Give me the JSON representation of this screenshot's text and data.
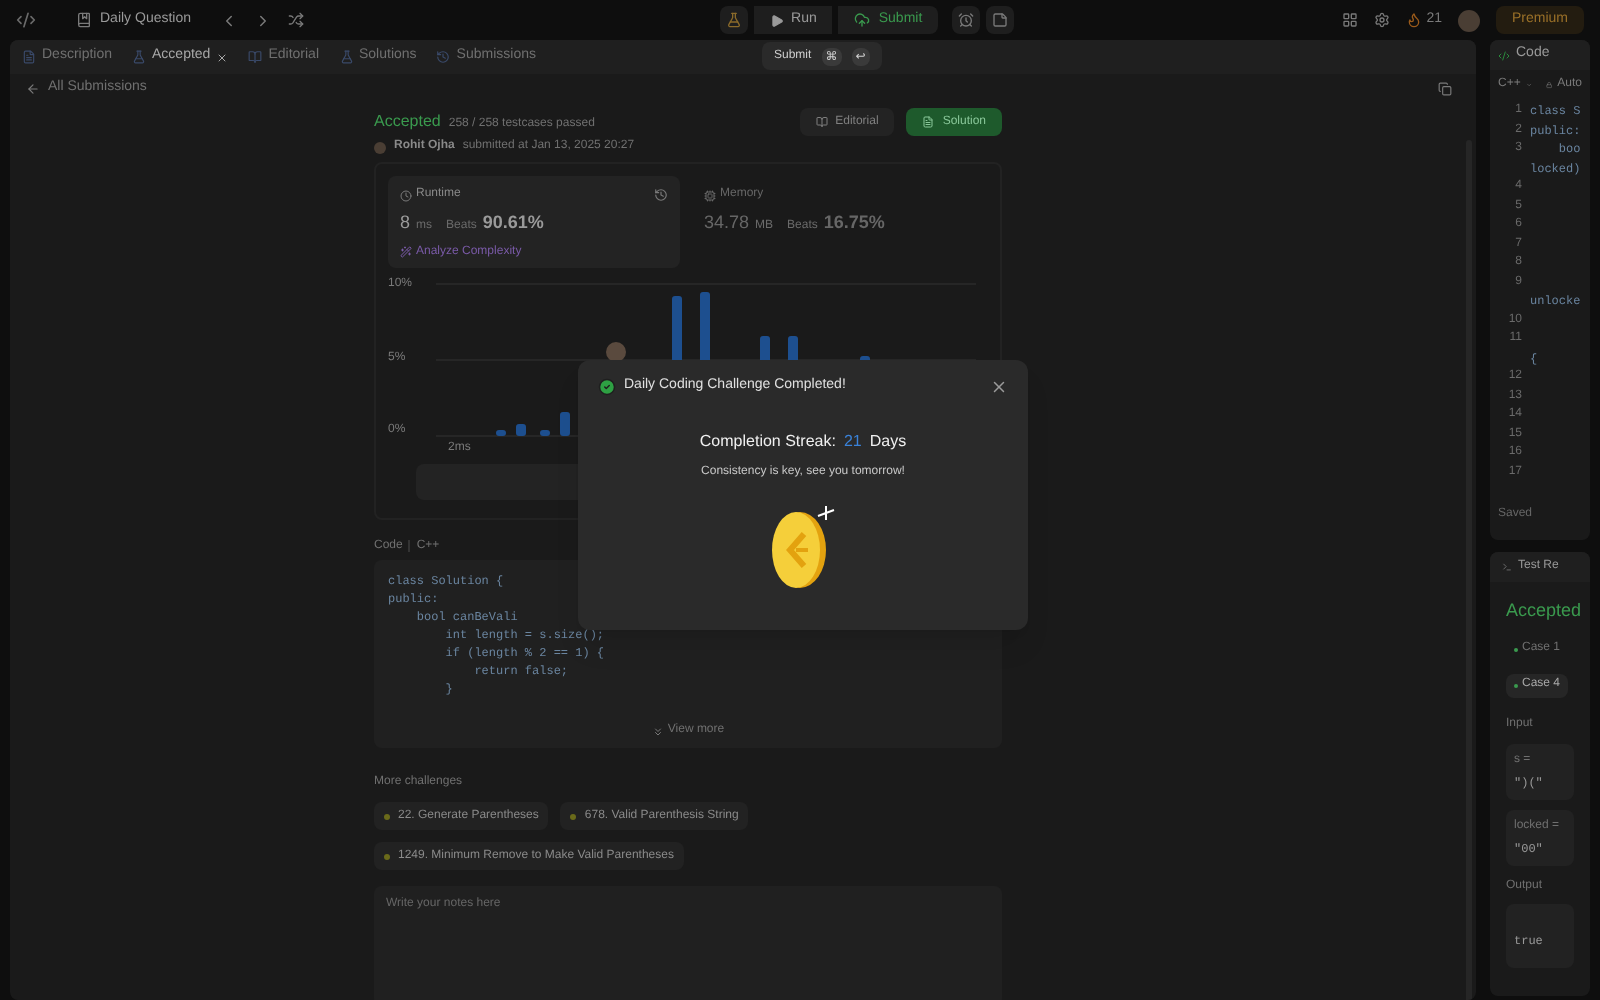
{
  "topbar": {
    "title": "Daily Question",
    "run": "Run",
    "submit": "Submit",
    "streak": "21",
    "premium": "Premium"
  },
  "submit_tooltip": {
    "label": "Submit",
    "keys": [
      "⌘",
      "↩"
    ]
  },
  "tabs": [
    {
      "label": "Description",
      "selected": false,
      "closable": false
    },
    {
      "label": "Accepted",
      "selected": true,
      "closable": true
    },
    {
      "label": "Editorial",
      "selected": false,
      "closable": false
    },
    {
      "label": "Solutions",
      "selected": false,
      "closable": false
    },
    {
      "label": "Submissions",
      "selected": false,
      "closable": false
    }
  ],
  "back_link": "All Submissions",
  "submission": {
    "status": "Accepted",
    "passed": "258 / 258 testcases passed",
    "author": "Rohit Ojha",
    "submitted": "submitted at Jan 13, 2025 20:27",
    "editorial": "Editorial",
    "solution": "Solution"
  },
  "stats": [
    {
      "label": "Runtime",
      "value": "8",
      "unit": "ms",
      "beats_label": "Beats",
      "beats": "90.61%",
      "selected": true
    },
    {
      "label": "Memory",
      "value": "34.78",
      "unit": "MB",
      "beats_label": "Beats",
      "beats": "16.75%",
      "selected": false
    }
  ],
  "analyze": "Analyze Complexity",
  "chart": {
    "yticks": [
      "10%",
      "5%",
      "0%"
    ],
    "xlabel": "2ms"
  },
  "code": {
    "label": "Code",
    "language": "C++",
    "lines": [
      "class Solution {",
      "public:",
      "    bool canBeVali",
      "        int length = s.size();",
      "        if (length % 2 == 1) {",
      "            return false;",
      "        }"
    ],
    "view_more": "View more"
  },
  "more_challenges": {
    "title": "More challenges",
    "items": [
      "22. Generate Parentheses",
      "678. Valid Parenthesis String",
      "1249. Minimum Remove to Make Valid Parentheses"
    ]
  },
  "notes": {
    "placeholder": "Write your notes here"
  },
  "editor_panel": {
    "title": "Code",
    "language": "C++",
    "mode": "Auto",
    "rows": [
      {
        "number": "1",
        "text": "class S"
      },
      {
        "number": "2",
        "text": "public:"
      },
      {
        "number": "3",
        "text": "    boo"
      },
      {
        "text": "locked)"
      },
      {
        "number": "4"
      },
      {
        "number": "5"
      },
      {
        "number": "6"
      },
      {
        "number": "7"
      },
      {
        "number": "8"
      },
      {
        "number": "9"
      },
      {
        "text": "unlocke"
      },
      {
        "number": "10"
      },
      {
        "number": "11"
      },
      {
        "text": "{"
      },
      {
        "number": "12"
      },
      {
        "number": "13"
      },
      {
        "number": "14"
      },
      {
        "number": "15"
      },
      {
        "number": "16"
      },
      {
        "number": "17"
      }
    ],
    "status": "Saved"
  },
  "result_panel": {
    "tab": "Test Re",
    "status": "Accepted",
    "cases": [
      {
        "label": "Case 1",
        "selected": false
      },
      {
        "label": "Case 4",
        "selected": true
      }
    ],
    "input_label": "Input",
    "params": [
      {
        "name": "s =",
        "value": "\")(\""
      },
      {
        "name": "locked =",
        "value": "\"00\""
      }
    ],
    "output_label": "Output",
    "output": "true"
  },
  "modal": {
    "title": "Daily Coding Challenge Completed!",
    "streak_label": "Completion Streak:",
    "streak": "21",
    "streak_unit": "Days",
    "message": "Consistency is key, see you tomorrow!"
  }
}
